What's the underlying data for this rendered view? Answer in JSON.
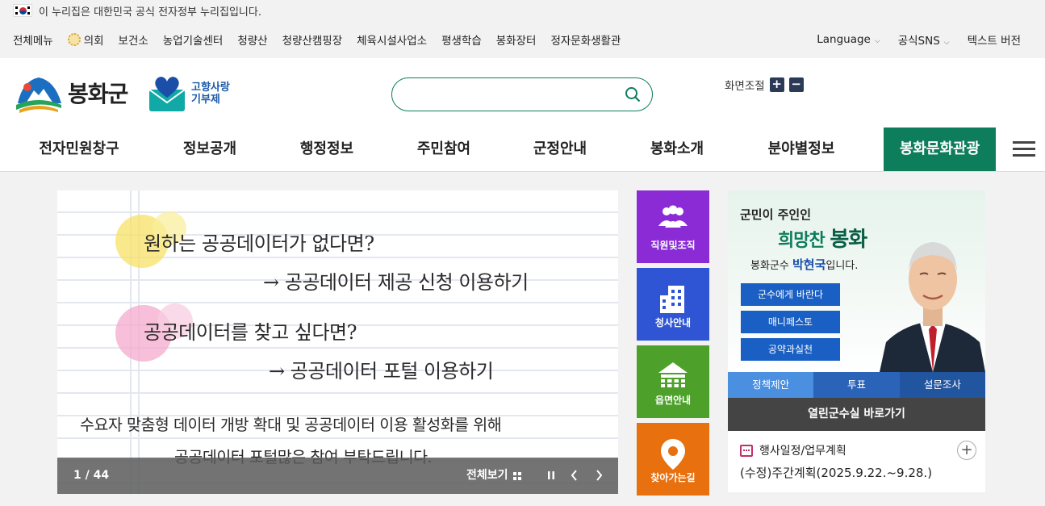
{
  "gov_banner": {
    "text": "이 누리집은 대한민국 공식 전자정부 누리집입니다."
  },
  "util": {
    "left": [
      "전체메뉴",
      "의회",
      "보건소",
      "농업기술센터",
      "청량산",
      "청량산캠핑장",
      "체육시설사업소",
      "평생학습",
      "봉화장터",
      "정자문화생활관"
    ],
    "language": "Language",
    "sns": "공식SNS",
    "text_version": "텍스트 버전"
  },
  "header": {
    "logo_text": "봉화군",
    "hometax_line1": "고향사랑",
    "hometax_line2": "기부제",
    "search_placeholder": "",
    "zoom_label": "화면조절",
    "zoom_in": "+",
    "zoom_out": "−"
  },
  "gnb": {
    "items": [
      "전자민원창구",
      "정보공개",
      "행정정보",
      "주민참여",
      "군정안내",
      "봉화소개",
      "분야별정보",
      "봉화문화관광"
    ]
  },
  "visual": {
    "line1": "원하는 공공데이터가 없다면?",
    "line2": "→ 공공데이터 제공 신청 이용하기",
    "line3": "공공데이터를 찾고 싶다면?",
    "line4": "→ 공공데이터 포털 이용하기",
    "line5": "수요자 맞춤형 데이터 개방 확대 및 공공데이터 이용 활성화를 위해",
    "line6": "공공데이터 포털많은 참여 부탁드립니다.",
    "counter": "1 / 44",
    "view_all": "전체보기"
  },
  "tiles": [
    {
      "label": "직원및조직",
      "color": "#8a2bd6"
    },
    {
      "label": "청사안내",
      "color": "#2f55d4"
    },
    {
      "label": "읍면안내",
      "color": "#4da12a"
    },
    {
      "label": "찾아가는길",
      "color": "#e8700e"
    }
  ],
  "mayor": {
    "sub": "군민이 주인인",
    "title_a": "희망찬 ",
    "title_b": "봉화",
    "name_pre": "봉화군수 ",
    "name": "박현국",
    "name_post": "입니다.",
    "buttons": [
      "군수에게 바란다",
      "매니페스토",
      "공약과실천"
    ],
    "tabs": [
      "정책제안",
      "투표",
      "설문조사"
    ],
    "link": "열린군수실 바로가기"
  },
  "schedule": {
    "title": "행사일정/업무계획",
    "plus": "+",
    "item": "(수정)주간계획(2025.9.22.~9.28.)"
  },
  "colors": {
    "primary_green": "#0e7d5c",
    "navy": "#2b3a57",
    "tab_blue": "#2a63b8"
  }
}
